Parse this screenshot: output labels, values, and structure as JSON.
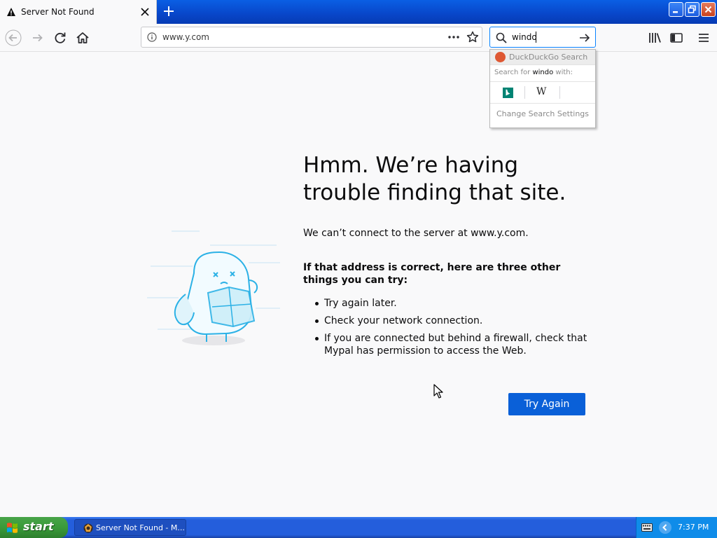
{
  "tab": {
    "title": "Server Not Found"
  },
  "window_controls": [
    "minimize",
    "restore",
    "close"
  ],
  "navbar": {
    "url": "www.y.com",
    "search_value": "windo"
  },
  "search_popup": {
    "engine_label": "DuckDuckGo Search",
    "search_for_prefix": "Search for ",
    "search_for_term": "windo",
    "search_for_suffix": " with:",
    "engines": [
      "bing-icon",
      "wikipedia-icon"
    ],
    "wiki_glyph": "W",
    "settings_label": "Change Search Settings"
  },
  "error_page": {
    "title": "Hmm. We’re having trouble finding that site.",
    "description": "We can’t connect to the server at www.y.com.",
    "subtitle": "If that address is correct, here are three other things you can try:",
    "suggestions": [
      "Try again later.",
      "Check your network connection.",
      "If you are connected but behind a firewall, check that Mypal has permission to access the Web."
    ],
    "button_label": "Try Again"
  },
  "taskbar": {
    "start_label": "start",
    "task_label": "Server Not Found - M...",
    "clock": "7:37 PM"
  },
  "colors": {
    "accent": "#0a60d8",
    "page_bg": "#f9f9fa",
    "title_bar": "#0846c9",
    "taskbar": "#245edc",
    "start_green": "#3a9a3a"
  }
}
